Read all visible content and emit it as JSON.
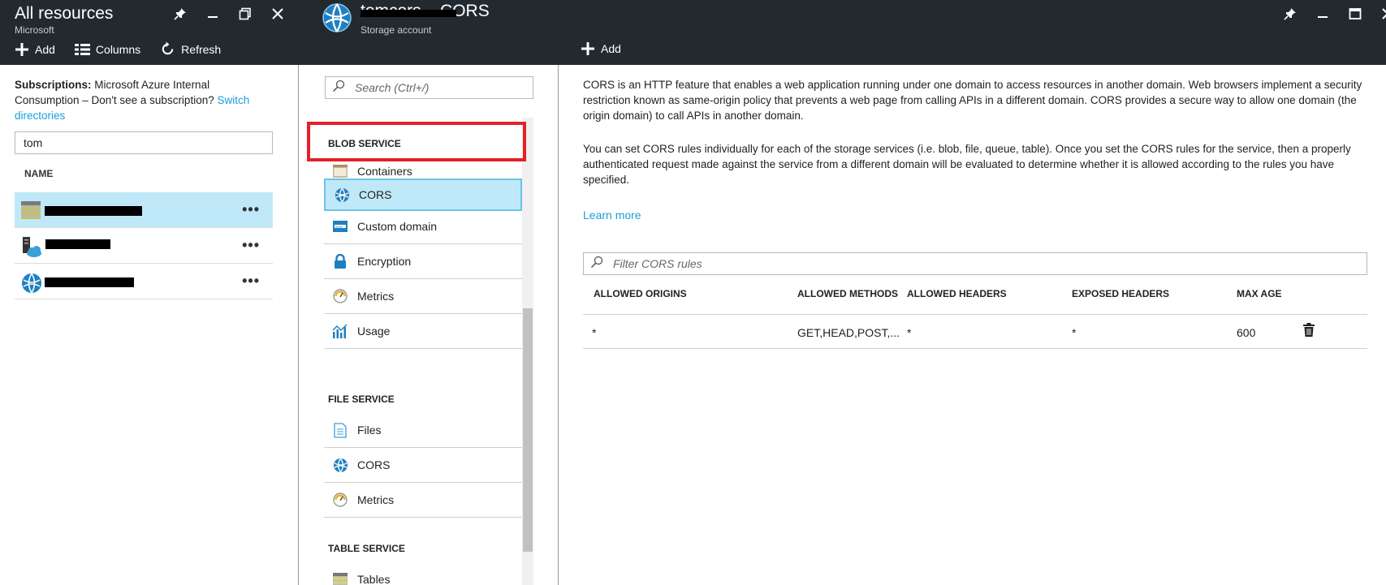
{
  "left_blade": {
    "title": "All resources",
    "subtitle": "Microsoft",
    "commands": {
      "add": "Add",
      "columns": "Columns",
      "refresh": "Refresh"
    },
    "subscriptions_label": "Subscriptions:",
    "subscriptions_text": " Microsoft Azure Internal Consumption – Don't see a subscription? ",
    "switch_link": "Switch directories",
    "filter_value": "tom",
    "name_header": "NAME",
    "more_label": "•••",
    "resources": [
      {
        "icon": "storage-table-icon",
        "selected": true
      },
      {
        "icon": "server-cloud-icon",
        "selected": false
      },
      {
        "icon": "cors-globe-icon",
        "selected": false
      }
    ]
  },
  "right_blade": {
    "title": "tomcors – CORS",
    "subtitle": "Storage account",
    "commands": {
      "add": "Add"
    },
    "search_placeholder": "Search (Ctrl+/)",
    "sections": {
      "blob": "BLOB SERVICE",
      "file": "FILE SERVICE",
      "table": "TABLE SERVICE"
    },
    "blob_items": [
      "Containers",
      "CORS",
      "Custom domain",
      "Encryption",
      "Metrics",
      "Usage"
    ],
    "file_items": [
      "Files",
      "CORS",
      "Metrics"
    ],
    "table_items": [
      "Tables"
    ],
    "description_1": "CORS is an HTTP feature that enables a web application running under one domain to access resources in another domain. Web browsers implement a security restriction known as same-origin policy that prevents a web page from calling APIs in a different domain. CORS provides a secure way to allow one domain (the origin domain) to call APIs in another domain.",
    "description_2": "You can set CORS rules individually for each of the storage services (i.e. blob, file, queue, table). Once you set the CORS rules for the service, then a properly authenticated request made against the service from a different domain will be evaluated to determine whether it is allowed according to the rules you have specified.",
    "learn_more": "Learn more",
    "filter_placeholder": "Filter CORS rules",
    "table": {
      "headers": [
        "ALLOWED ORIGINS",
        "ALLOWED METHODS",
        "ALLOWED HEADERS",
        "EXPOSED HEADERS",
        "MAX AGE"
      ],
      "rows": [
        [
          "*",
          "GET,HEAD,POST,...",
          "*",
          "*",
          "600"
        ]
      ]
    }
  },
  "colors": {
    "header_bg": "#222a30",
    "accent": "#1a9ed8",
    "selected_bg": "#bfe9f8",
    "highlight_box": "#e5202a"
  }
}
